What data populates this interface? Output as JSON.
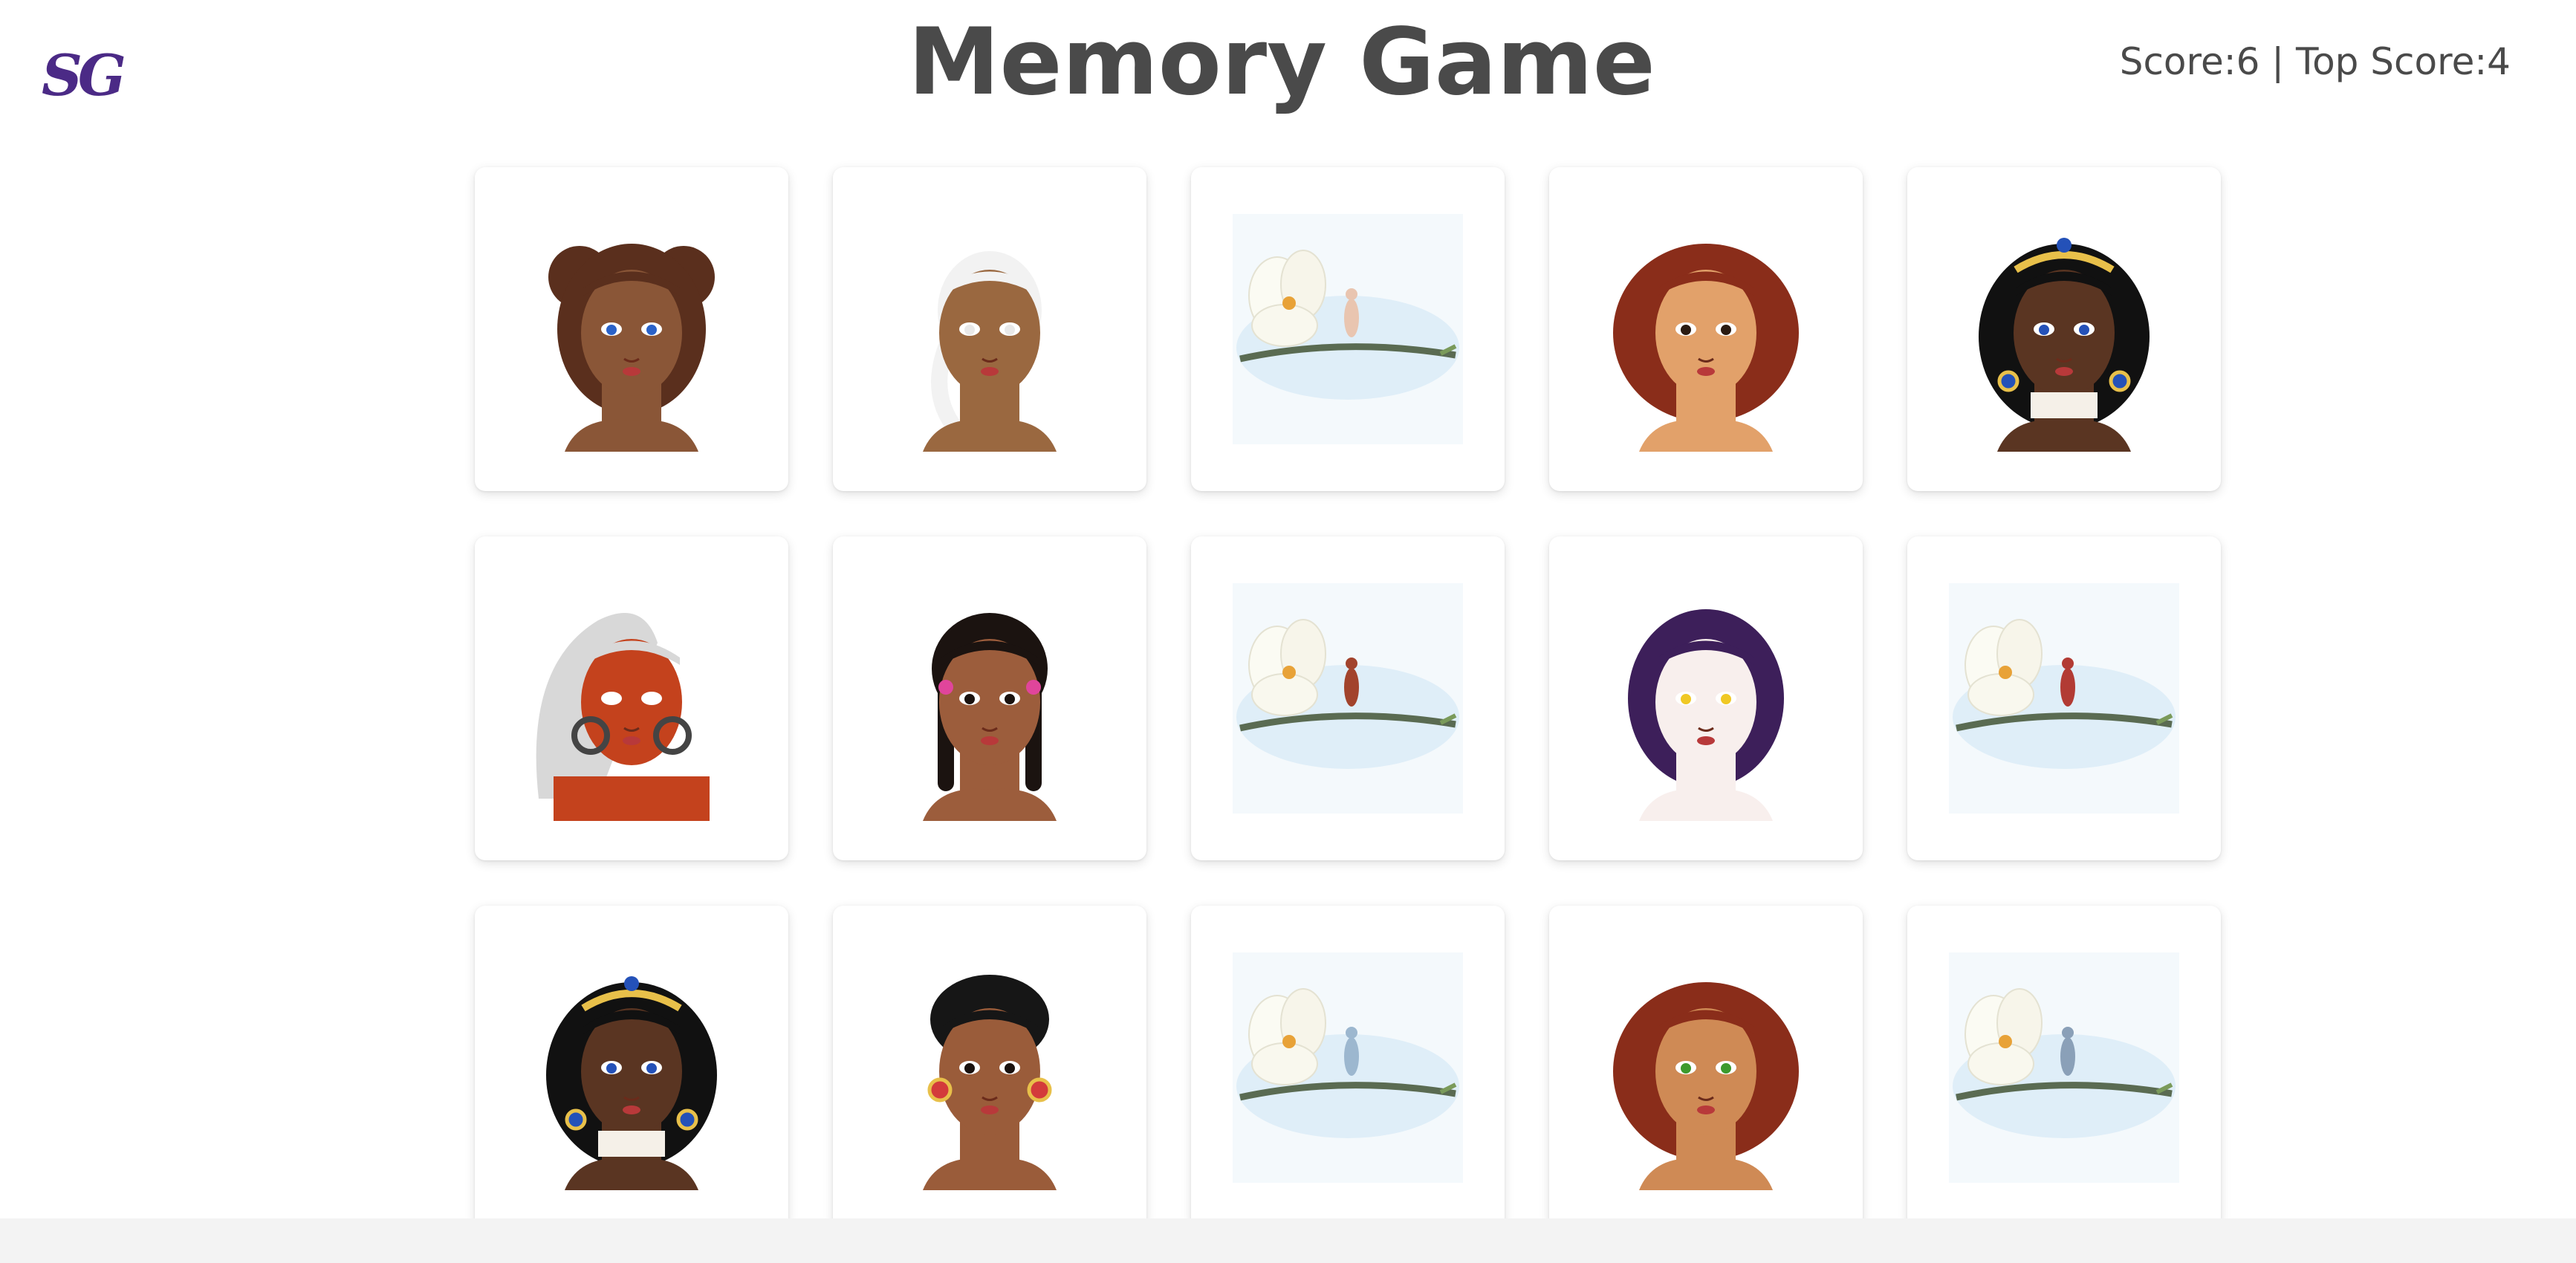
{
  "header": {
    "logo": "SG",
    "title": "Memory Game",
    "score_text": "Score:6 | Top Score:4"
  },
  "cards": [
    {
      "icon": "girl-brown-buns-blue-eyes-portrait",
      "skin": "#8a5637",
      "hair": "#5a2f1d",
      "eyes": "#2a62c9",
      "style": "buns"
    },
    {
      "icon": "girl-white-hair-portrait",
      "skin": "#9a6840",
      "hair": "#f2f2f2",
      "eyes": "#e8e8e8",
      "style": "white"
    },
    {
      "icon": "fairy-on-magnolia-branch-image",
      "fairy": "#e9c5b0"
    },
    {
      "icon": "girl-auburn-hair-freckles-sad-portrait",
      "skin": "#e2a16a",
      "hair": "#8a2d1a",
      "eyes": "#2b1b12",
      "style": "curly"
    },
    {
      "icon": "girl-tiara-black-hair-portrait",
      "skin": "#5a3522",
      "hair": "#111111",
      "eyes": "#2451b8",
      "style": "tiara"
    },
    {
      "icon": "girl-red-face-silver-hair-portrait",
      "skin": "#c4421d",
      "hair": "#d8d8d8",
      "eyes": "#ffffff",
      "style": "silver"
    },
    {
      "icon": "girl-braids-pink-bows-portrait",
      "skin": "#9c5d3c",
      "hair": "#1b1310",
      "eyes": "#1b1310",
      "style": "braids"
    },
    {
      "icon": "fairy-on-magnolia-branch-image",
      "fairy": "#a2432c"
    },
    {
      "icon": "girl-purple-hair-pale-face-portrait",
      "skin": "#f8efed",
      "hair": "#3d1f5a",
      "eyes": "#f0c824",
      "style": "purple"
    },
    {
      "icon": "fairy-sitting-magnolia-branch-image",
      "fairy": "#b23b34"
    },
    {
      "icon": "girl-tiara-black-hair-angry-portrait",
      "skin": "#5a3522",
      "hair": "#111111",
      "eyes": "#2451b8",
      "style": "tiara"
    },
    {
      "icon": "girl-short-curly-hair-portrait",
      "skin": "#9a5c3a",
      "hair": "#161616",
      "eyes": "#1b1310",
      "style": "short"
    },
    {
      "icon": "fairy-on-magnolia-branch-image",
      "fairy": "#9cb7cf"
    },
    {
      "icon": "girl-auburn-hair-green-eyes-portrait",
      "skin": "#cf8a55",
      "hair": "#8a2d1a",
      "eyes": "#3c9a2d",
      "style": "curly"
    },
    {
      "icon": "fairy-on-magnolia-branch-image",
      "fairy": "#8aa0b8"
    }
  ]
}
